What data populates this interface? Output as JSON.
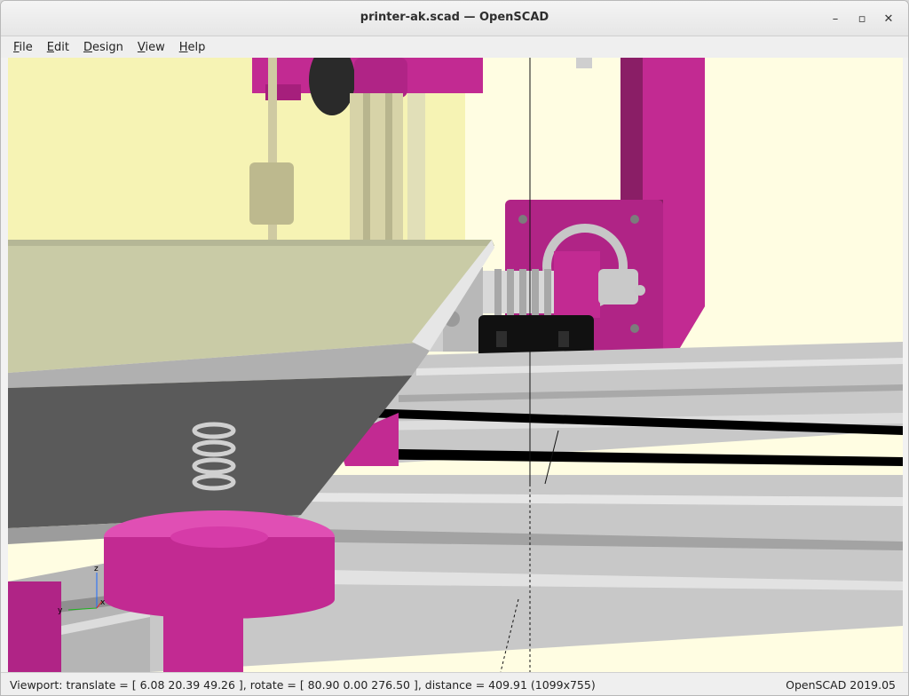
{
  "window": {
    "title": "printer-ak.scad — OpenSCAD",
    "controls": {
      "minimize": "–",
      "maximize": "▫",
      "close": "✕"
    }
  },
  "menu": {
    "items": [
      {
        "label": "File",
        "underline": "F",
        "rest": "ile"
      },
      {
        "label": "Edit",
        "underline": "E",
        "rest": "dit"
      },
      {
        "label": "Design",
        "underline": "D",
        "rest": "esign"
      },
      {
        "label": "View",
        "underline": "V",
        "rest": "iew"
      },
      {
        "label": "Help",
        "underline": "H",
        "rest": "elp"
      }
    ]
  },
  "viewport": {
    "axes": {
      "z": "z",
      "y": "y",
      "x": "x"
    },
    "colors": {
      "background": "#fffde2",
      "magenta": "#cc2e9c",
      "magenta_dark": "#8a1e66",
      "aluminium": "#c8c8c8",
      "bed_top": "#c9cba6",
      "bed_side": "#5a5a5a"
    }
  },
  "status": {
    "viewport_info": "Viewport: translate = [ 6.08 20.39 49.26 ], rotate = [ 80.90 0.00 276.50 ], distance = 409.91 (1099x755)",
    "version": "OpenSCAD 2019.05"
  }
}
